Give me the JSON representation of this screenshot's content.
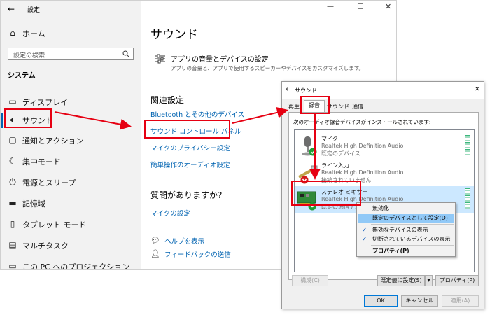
{
  "settings": {
    "back": "←",
    "title": "設定",
    "window_controls": {
      "min": "—",
      "max": "☐",
      "close": "✕"
    },
    "home": "ホーム",
    "search_placeholder": "設定の検索",
    "system_heading": "システム",
    "sidebar_items": [
      {
        "label": "ディスプレイ",
        "icon": "display-icon"
      },
      {
        "label": "サウンド",
        "icon": "speaker-icon"
      },
      {
        "label": "通知とアクション",
        "icon": "notification-icon"
      },
      {
        "label": "集中モード",
        "icon": "moon-icon"
      },
      {
        "label": "電源とスリープ",
        "icon": "power-icon"
      },
      {
        "label": "記憶域",
        "icon": "storage-icon"
      },
      {
        "label": "タブレット モード",
        "icon": "tablet-icon"
      },
      {
        "label": "マルチタスク",
        "icon": "multitask-icon"
      },
      {
        "label": "この PC へのプロジェクション",
        "icon": "projection-icon"
      }
    ],
    "main": {
      "page_title": "サウンド",
      "app_volume_title": "アプリの音量とデバイスの設定",
      "app_volume_desc": "アプリの音量と、アプリで使用するスピーカーやデバイスをカスタマイズします。",
      "related_heading": "関連設定",
      "related_links": [
        "Bluetooth とその他のデバイス",
        "サウンド コントロール パネル",
        "マイクのプライバシー設定",
        "簡単操作のオーディオ設定"
      ],
      "question_heading": "質問がありますか?",
      "question_link": "マイクの設定",
      "help_link": "ヘルプを表示",
      "feedback_link": "フィードバックの送信"
    }
  },
  "sound_dialog": {
    "title": "サウンド",
    "close": "✕",
    "tabs": [
      "再生",
      "録音",
      "サウンド",
      "通信"
    ],
    "active_tab": "録音",
    "instruction": "次のオーディオ録音デバイスがインストールされています:",
    "devices": [
      {
        "name": "マイク",
        "driver": "Realtek High Definition Audio",
        "status": "既定のデバイス",
        "badge": "check"
      },
      {
        "name": "ライン入力",
        "driver": "Realtek High Definition Audio",
        "status": "接続されていません",
        "badge": "down"
      },
      {
        "name": "ステレオ ミキサー",
        "driver": "Realtek High Definition Audio",
        "status": "既定の通信デバイス",
        "badge": "phone"
      }
    ],
    "buttons": {
      "configure": "構成(C)",
      "set_default": "既定値に設定(S)",
      "dropdown": "▾",
      "properties": "プロパティ(P)",
      "ok": "OK",
      "cancel": "キャンセル",
      "apply": "適用(A)"
    },
    "context_menu": [
      {
        "label": "無効化",
        "checked": false
      },
      {
        "label": "既定のデバイスとして設定(D)",
        "checked": false,
        "highlighted": true
      },
      {
        "label": "無効なデバイスの表示",
        "checked": true
      },
      {
        "label": "切断されているデバイスの表示",
        "checked": true
      },
      {
        "label": "プロパティ(P)",
        "checked": false,
        "bold": true
      }
    ]
  },
  "colors": {
    "accent": "#0063b1",
    "annotation": "#e60012",
    "selection": "#cce8ff",
    "meter": "#3cb77d"
  }
}
